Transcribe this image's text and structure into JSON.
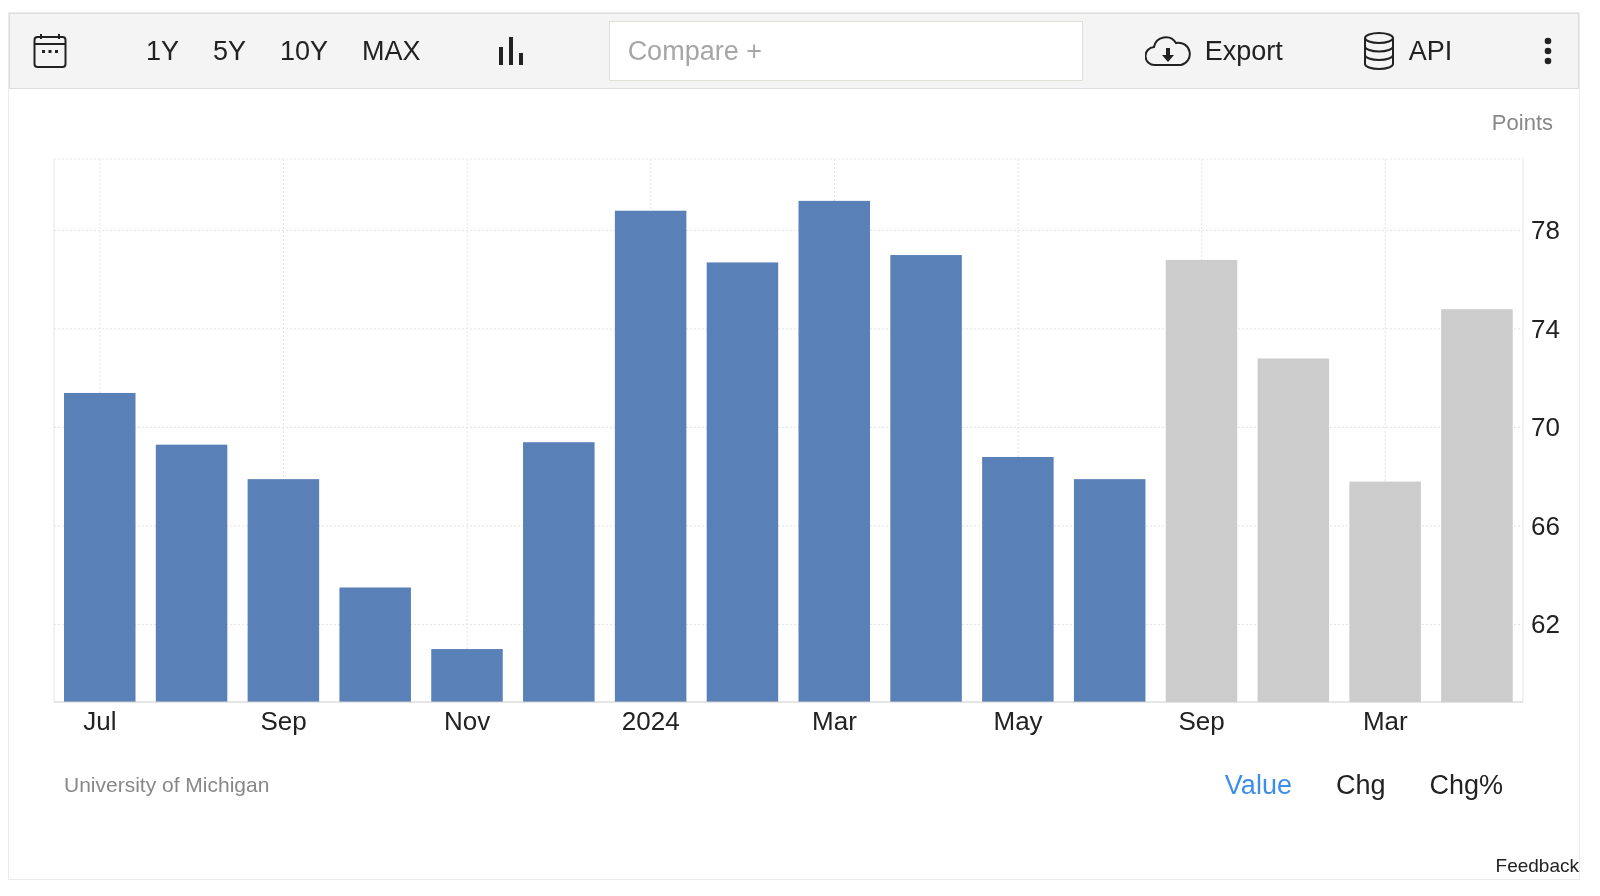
{
  "toolbar": {
    "ranges": [
      "1Y",
      "5Y",
      "10Y",
      "MAX"
    ],
    "compare": {
      "placeholder": "Compare +"
    },
    "export": "Export",
    "api": "API"
  },
  "chart": {
    "chart_data": {
      "type": "bar",
      "ylabel": "Points",
      "categories": [
        "Jul",
        null,
        "Sep",
        null,
        "Nov",
        null,
        "2024",
        null,
        "Mar",
        null,
        "May",
        null,
        "Sep",
        null,
        "Mar",
        null
      ],
      "series": [
        {
          "color": "#5a80b8",
          "values": [
            71.4,
            69.3,
            67.9,
            63.5,
            61.0,
            69.4,
            78.8,
            76.7,
            79.2,
            77.0,
            68.8,
            67.9,
            null,
            null,
            null,
            null
          ]
        },
        {
          "color": "#cccccc",
          "values": [
            null,
            null,
            null,
            null,
            null,
            null,
            null,
            null,
            null,
            null,
            null,
            null,
            76.8,
            72.8,
            67.8,
            74.8
          ]
        }
      ],
      "grid": true,
      "ylim": [
        58.85,
        80.9
      ],
      "yticks": [
        62,
        66,
        70,
        74,
        78
      ]
    }
  },
  "source": "University of Michigan",
  "views": [
    {
      "label": "Value",
      "selected": true
    },
    {
      "label": "Chg",
      "selected": false
    },
    {
      "label": "Chg%",
      "selected": false
    }
  ],
  "feedback": "Feedback"
}
